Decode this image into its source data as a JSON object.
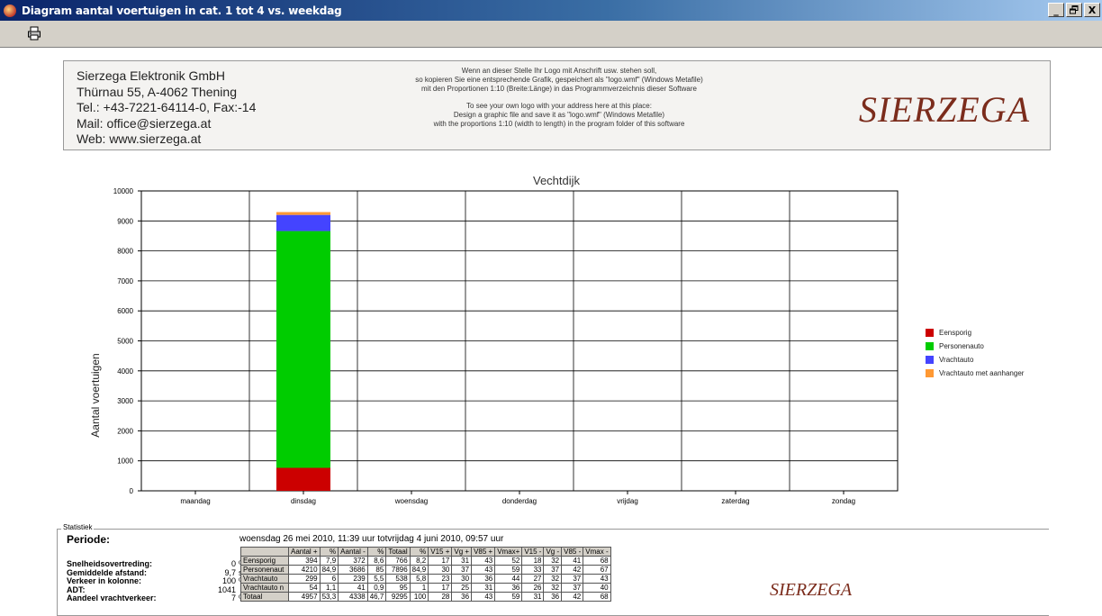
{
  "window": {
    "title": "Diagram aantal voertuigen in cat. 1 tot 4 vs. weekdag",
    "minimize": "_",
    "restore": "̸",
    "close": "X",
    "app_icon": "app-icon",
    "print_icon": "printer-icon"
  },
  "header": {
    "company_lines": [
      "Sierzega Elektronik GmbH",
      "Thürnau 55, A-4062 Thening",
      "Tel.: +43-7221-64114-0, Fax:-14",
      "Mail: office@sierzega.at",
      "Web: www.sierzega.at"
    ],
    "notice_lines": [
      "Wenn an dieser Stelle Ihr Logo mit Anschrift usw. stehen soll,",
      "so kopieren Sie eine entsprechende Grafik, gespeichert als \"logo.wmf\" (Windows Metafile)",
      "mit den Proportionen 1:10 (Breite:Länge) in das Programmverzeichnis dieser Software",
      "",
      "To see your own logo with your address here at this place:",
      "Design a graphic file and save it as \"logo.wmf\" (Windows Metafile)",
      "with the proportions 1:10 (width to length) in the program folder of this software"
    ],
    "logo": "SIERZEGA"
  },
  "chart_data": {
    "type": "bar",
    "stacked": true,
    "title": "Vechtdijk",
    "ylabel": "Aantal voertuigen",
    "xlabel": "",
    "ylim": [
      0,
      10000
    ],
    "yticks": [
      0,
      1000,
      2000,
      3000,
      4000,
      5000,
      6000,
      7000,
      8000,
      9000,
      10000
    ],
    "categories": [
      "maandag",
      "dinsdag",
      "woensdag",
      "donderdag",
      "vrijdag",
      "zaterdag",
      "zondag"
    ],
    "series": [
      {
        "name": "Eensporig",
        "color": "#cc0000",
        "values": [
          0,
          766,
          0,
          0,
          0,
          0,
          0
        ]
      },
      {
        "name": "Personenauto",
        "color": "#00cc00",
        "values": [
          0,
          7896,
          0,
          0,
          0,
          0,
          0
        ]
      },
      {
        "name": "Vrachtauto",
        "color": "#4444ff",
        "values": [
          0,
          538,
          0,
          0,
          0,
          0,
          0
        ]
      },
      {
        "name": "Vrachtauto met aanhanger",
        "color": "#ff9933",
        "values": [
          0,
          95,
          0,
          0,
          0,
          0,
          0
        ]
      }
    ],
    "grid": true,
    "legend": "right"
  },
  "stats": {
    "group_label": "Statistiek",
    "periode_label": "Periode:",
    "periode_text": "woensdag 26 mei 2010, 11:39 uur totvrijdag 4 juni 2010, 09:57 uur",
    "kpis": [
      {
        "label": "Snelheidsovertreding:",
        "value": "0",
        "unit": "%"
      },
      {
        "label": "Gemiddelde afstand:",
        "value": "9,7",
        "unit": "sec."
      },
      {
        "label": "Verkeer in kolonne:",
        "value": "100",
        "unit": "%"
      },
      {
        "label": "ADT:",
        "value": "1041",
        "unit": ""
      },
      {
        "label": "Aandeel vrachtverkeer:",
        "value": "7",
        "unit": "%"
      }
    ],
    "columns": [
      "",
      "Aantal +",
      "%",
      "Aantal -",
      "%",
      "Totaal",
      "%",
      "V15 +",
      "Vg +",
      "V85 +",
      "Vmax+",
      "V15 -",
      "Vg -",
      "V85 -",
      "Vmax -"
    ],
    "rows": [
      [
        "Eensporig",
        "394",
        "7,9",
        "372",
        "8,6",
        "766",
        "8,2",
        "17",
        "31",
        "43",
        "52",
        "18",
        "32",
        "41",
        "68"
      ],
      [
        "Personenaut",
        "4210",
        "84,9",
        "3686",
        "85",
        "7896",
        "84,9",
        "30",
        "37",
        "43",
        "59",
        "33",
        "37",
        "42",
        "67"
      ],
      [
        "Vrachtauto",
        "299",
        "6",
        "239",
        "5,5",
        "538",
        "5,8",
        "23",
        "30",
        "36",
        "44",
        "27",
        "32",
        "37",
        "43"
      ],
      [
        "Vrachtauto n",
        "54",
        "1,1",
        "41",
        "0,9",
        "95",
        "1",
        "17",
        "25",
        "31",
        "36",
        "26",
        "32",
        "37",
        "40"
      ],
      [
        "Totaal",
        "4957",
        "53,3",
        "4338",
        "46,7",
        "9295",
        "100",
        "28",
        "36",
        "43",
        "59",
        "31",
        "36",
        "42",
        "68"
      ]
    ]
  }
}
